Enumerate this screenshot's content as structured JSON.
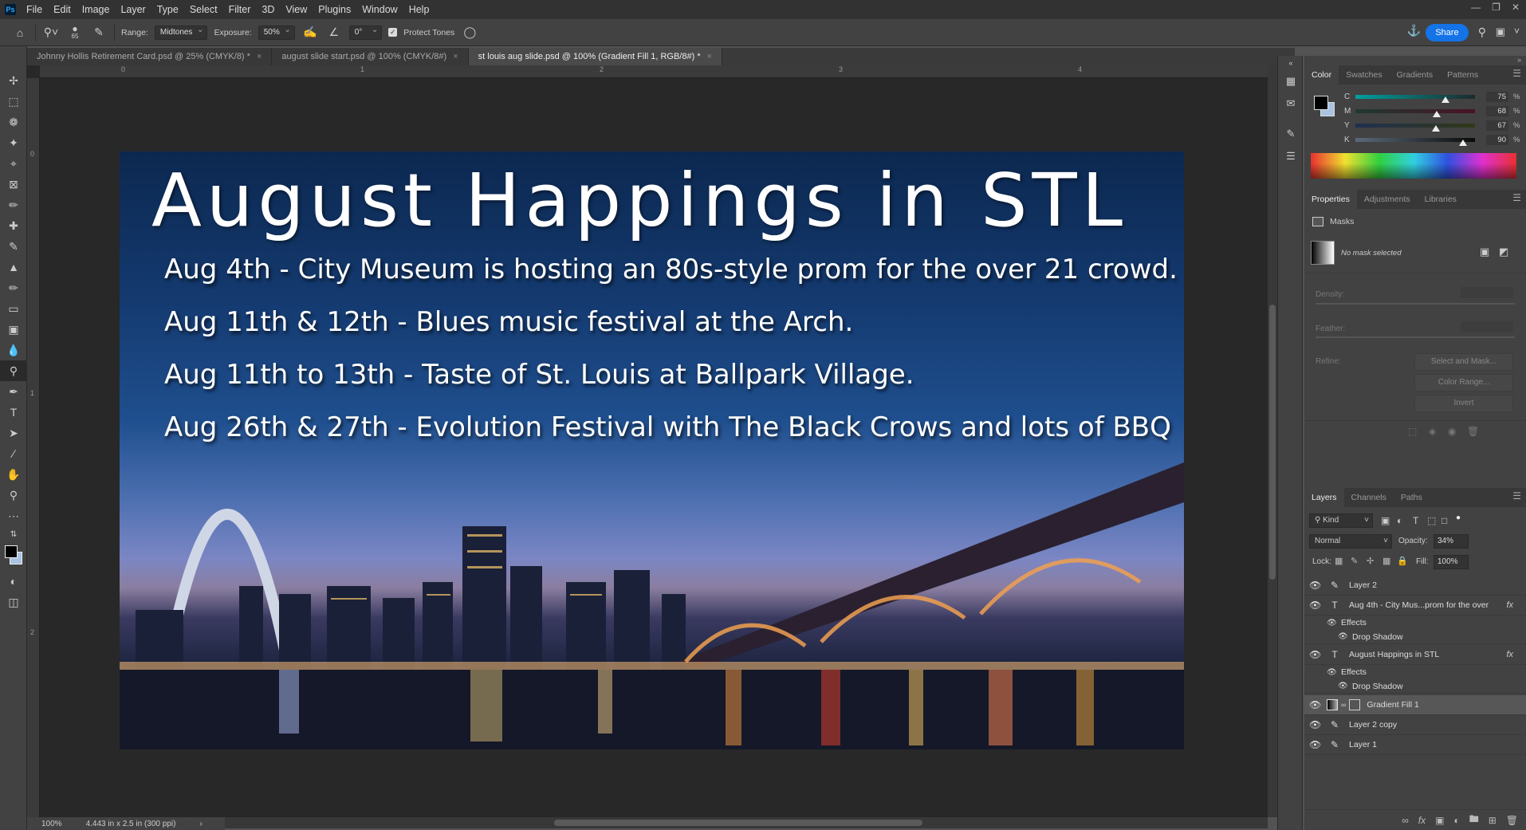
{
  "menu": [
    "File",
    "Edit",
    "Image",
    "Layer",
    "Type",
    "Select",
    "Filter",
    "3D",
    "View",
    "Plugins",
    "Window",
    "Help"
  ],
  "app_logo": "Ps",
  "options": {
    "brush_size": "65",
    "range_label": "Range:",
    "range_value": "Midtones",
    "exposure_label": "Exposure:",
    "exposure_value": "50%",
    "angle_value": "0°",
    "protect_tones_label": "Protect Tones",
    "share_label": "Share"
  },
  "tabs": [
    {
      "label": "Johnny Hollis Retirement Card.psd @ 25% (CMYK/8) *",
      "active": false
    },
    {
      "label": "august slide start.psd @ 100% (CMYK/8#)",
      "active": false
    },
    {
      "label": "st louis aug slide.psd @ 100% (Gradient Fill 1, RGB/8#) *",
      "active": true
    }
  ],
  "ruler_h": [
    "0",
    "1",
    "2",
    "3",
    "4"
  ],
  "ruler_v": [
    "0",
    "1",
    "2"
  ],
  "document": {
    "title": "August Happings in STL",
    "events": [
      "Aug 4th - City Museum is hosting an 80s-style prom for the over 21 crowd.",
      "Aug 11th & 12th - Blues music festival at the Arch.",
      "Aug 11th to 13th - Taste of St. Louis at Ballpark Village.",
      "Aug 26th & 27th - Evolution Festival with The Black Crows and lots of BBQ"
    ]
  },
  "status": {
    "zoom": "100%",
    "size": "4.443 in x 2.5 in (300 ppi)"
  },
  "color_panel": {
    "tabs": [
      "Color",
      "Swatches",
      "Gradients",
      "Patterns"
    ],
    "channels": [
      {
        "label": "C",
        "value": "75",
        "pct": "%",
        "level": 0.75,
        "color_from": "#00a0a0",
        "color_to": "#1e2a2a"
      },
      {
        "label": "M",
        "value": "68",
        "pct": "%",
        "level": 0.68,
        "color_from": "#1e3a30",
        "color_to": "#4a1228"
      },
      {
        "label": "Y",
        "value": "67",
        "pct": "%",
        "level": 0.67,
        "color_from": "#203050",
        "color_to": "#303818"
      },
      {
        "label": "K",
        "value": "90",
        "pct": "%",
        "level": 0.9,
        "color_from": "#5a6a7a",
        "color_to": "#0a0a0a"
      }
    ]
  },
  "properties_panel": {
    "tabs": [
      "Properties",
      "Adjustments",
      "Libraries"
    ],
    "masks_label": "Masks",
    "no_mask": "No mask selected",
    "density": "Density:",
    "feather": "Feather:",
    "refine": "Refine:",
    "select_and_mask": "Select and Mask...",
    "color_range": "Color Range...",
    "invert": "Invert"
  },
  "layers_panel": {
    "tabs": [
      "Layers",
      "Channels",
      "Paths"
    ],
    "kind": "Kind",
    "blend_mode": "Normal",
    "opacity_label": "Opacity:",
    "opacity_value": "34%",
    "lock_label": "Lock:",
    "fill_label": "Fill:",
    "fill_value": "100%",
    "fx": "fx",
    "layers": [
      {
        "name": "Layer 2",
        "type": "brush",
        "sub": false
      },
      {
        "name": "Aug 4th - City Mus...prom for the over",
        "type": "text",
        "sub": false,
        "fx": true
      },
      {
        "name": "Effects",
        "type": "effects",
        "sub": true
      },
      {
        "name": "Drop Shadow",
        "type": "effect",
        "sub": true
      },
      {
        "name": "August Happings in STL",
        "type": "text",
        "sub": false,
        "fx": true
      },
      {
        "name": "Effects",
        "type": "effects",
        "sub": true
      },
      {
        "name": "Drop Shadow",
        "type": "effect",
        "sub": true
      },
      {
        "name": "Gradient Fill 1",
        "type": "fill",
        "sub": false,
        "selected": true
      },
      {
        "name": "Layer 2 copy",
        "type": "brush",
        "sub": false
      },
      {
        "name": "Layer 1",
        "type": "brush",
        "sub": false
      }
    ]
  },
  "colors": {
    "accent": "#1473e6",
    "panel": "#424242",
    "canvas_bg": "#282828"
  }
}
